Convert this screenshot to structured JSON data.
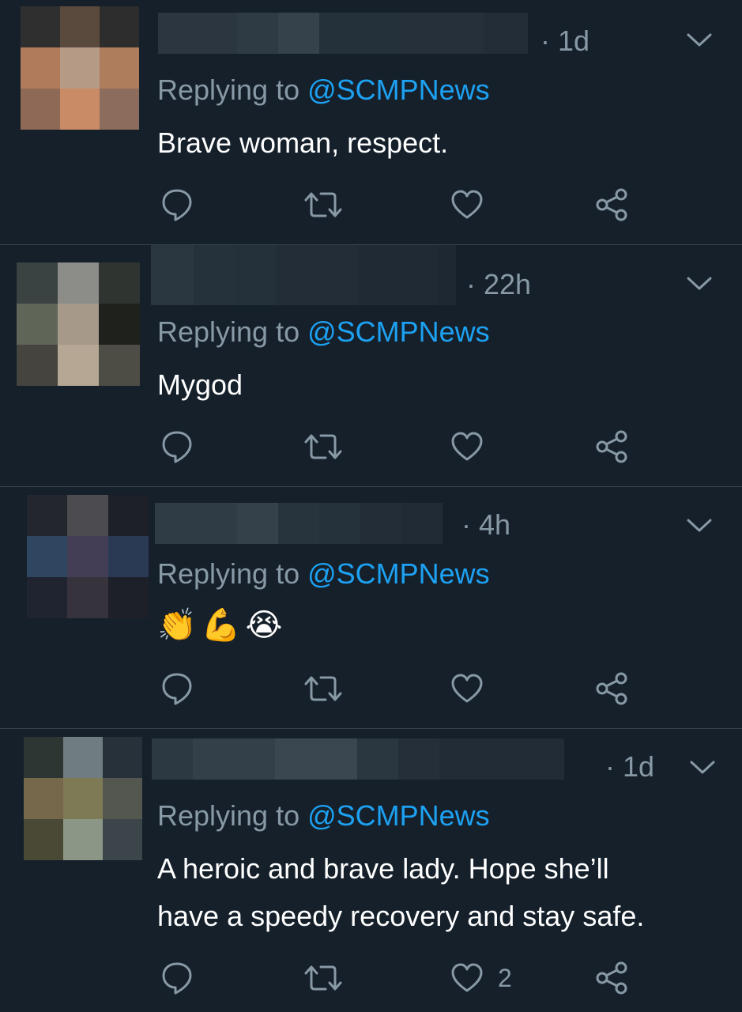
{
  "tweets": [
    {
      "time_label": "· 1d",
      "replying_prefix": "Replying to ",
      "replying_handle": "@SCMPNews",
      "text_lines": [
        "Brave woman, respect."
      ],
      "like_count": "",
      "avatar_colors": [
        "#2f2f2f",
        "#5a4a3e",
        "#2d2d2d",
        "#b07b5a",
        "#b59a86",
        "#ad7d5c",
        "#8e6a56",
        "#c98b66",
        "#8c6c5c"
      ],
      "name_blur_colors": [
        "#2b3640",
        "#2e3a44",
        "#35424c",
        "#24303a",
        "#25303a",
        "#222d37"
      ]
    },
    {
      "time_label": "· 22h",
      "replying_prefix": "Replying to ",
      "replying_handle": "@SCMPNews",
      "text_lines": [
        "Mygod"
      ],
      "like_count": "",
      "avatar_colors": [
        "#3b4242",
        "#8c8c88",
        "#2f3431",
        "#5f6657",
        "#a6998a",
        "#1f211c",
        "#45443f",
        "#b5a793",
        "#4d4d46"
      ],
      "name_blur_colors": [
        "#2a3640",
        "#25313b",
        "#24303a",
        "#222d37",
        "#1f2a34",
        "#1d2832"
      ]
    },
    {
      "time_label": "· 4h",
      "replying_prefix": "Replying to ",
      "replying_handle": "@SCMPNews",
      "text_lines": [
        ""
      ],
      "emojis": [
        "👏",
        "💪",
        "😭"
      ],
      "like_count": "",
      "avatar_colors": [
        "#24262d",
        "#4c4b50",
        "#1d2027",
        "#2f4660",
        "#433e55",
        "#2a3a55",
        "#202330",
        "#37333d",
        "#1e2029"
      ],
      "name_blur_colors": [
        "#2f3b45",
        "#34414b",
        "#27333d",
        "#25313b",
        "#222d37",
        "#202b35"
      ]
    },
    {
      "time_label": "· 1d",
      "replying_prefix": "Replying to ",
      "replying_handle": "@SCMPNews",
      "text_lines": [
        "A heroic and brave lady. Hope she’ll",
        "have a speedy recovery and stay safe."
      ],
      "like_count": "2",
      "avatar_colors": [
        "#2e3634",
        "#6f7c80",
        "#27313a",
        "#76684a",
        "#7e7a55",
        "#53574f",
        "#4a4936",
        "#8c9686",
        "#3c454a"
      ],
      "name_blur_colors": [
        "#2c3842",
        "#33404a",
        "#3a4650",
        "#2a3640",
        "#252f39",
        "#222c36"
      ]
    }
  ],
  "colors": {
    "background": "#15202b",
    "divider": "#38444d",
    "secondary_text": "#8899a6",
    "accent": "#1da1f2"
  },
  "icons": [
    "reply-icon",
    "retweet-icon",
    "like-icon",
    "share-icon",
    "chevron-down-icon"
  ]
}
